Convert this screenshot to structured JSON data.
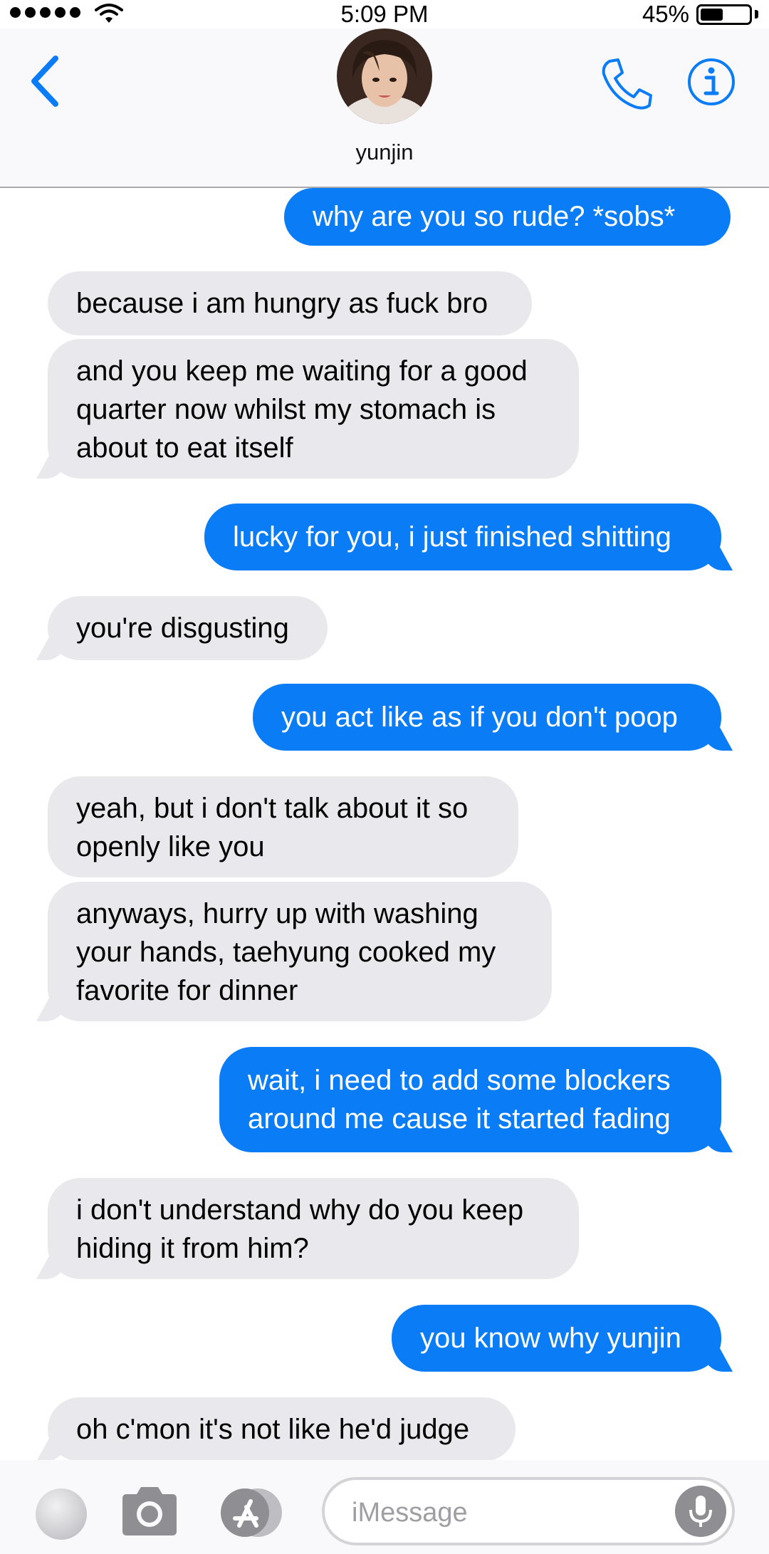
{
  "status_bar": {
    "time": "5:09 PM",
    "battery_percent": "45%",
    "battery_level": 0.45,
    "signal_bars": 5
  },
  "header": {
    "contact_name": "yunjin",
    "back_icon": "chevron-left-icon",
    "call_icon": "phone-icon",
    "info_icon": "info-icon"
  },
  "messages": [
    {
      "from": "me",
      "lines": [
        "why are you so rude? *sobs*"
      ]
    },
    {
      "from": "them",
      "lines": [
        "because i am hungry as fuck bro"
      ]
    },
    {
      "from": "them",
      "lines": [
        "and you keep me waiting for a good",
        "quarter now whilst my stomach is",
        "about to eat itself"
      ]
    },
    {
      "from": "me",
      "lines": [
        "lucky for you, i just finished shitting"
      ]
    },
    {
      "from": "them",
      "lines": [
        "you're disgusting"
      ]
    },
    {
      "from": "me",
      "lines": [
        "you act like as if you don't poop"
      ]
    },
    {
      "from": "them",
      "lines": [
        "yeah, but i don't talk about it so",
        "openly like you"
      ]
    },
    {
      "from": "them",
      "lines": [
        "anyways, hurry up with washing",
        "your hands, taehyung cooked my",
        "favorite for dinner"
      ]
    },
    {
      "from": "me",
      "lines": [
        "wait, i need to add some blockers",
        "around me cause it started fading"
      ]
    },
    {
      "from": "them",
      "lines": [
        "i don't understand why do you keep",
        "hiding it from him?"
      ]
    },
    {
      "from": "me",
      "lines": [
        "you know why yunjin"
      ]
    },
    {
      "from": "them",
      "lines": [
        "oh c'mon it's not like he'd judge"
      ]
    }
  ],
  "input_bar": {
    "placeholder": "iMessage",
    "value": "",
    "icons": [
      "photo-thumbnail-icon",
      "camera-icon",
      "app-store-icon",
      "microphone-icon"
    ]
  },
  "colors": {
    "sent_bubble": "#0a7cf5",
    "received_bubble": "#e9e9ed",
    "accent": "#0a7cf5"
  }
}
